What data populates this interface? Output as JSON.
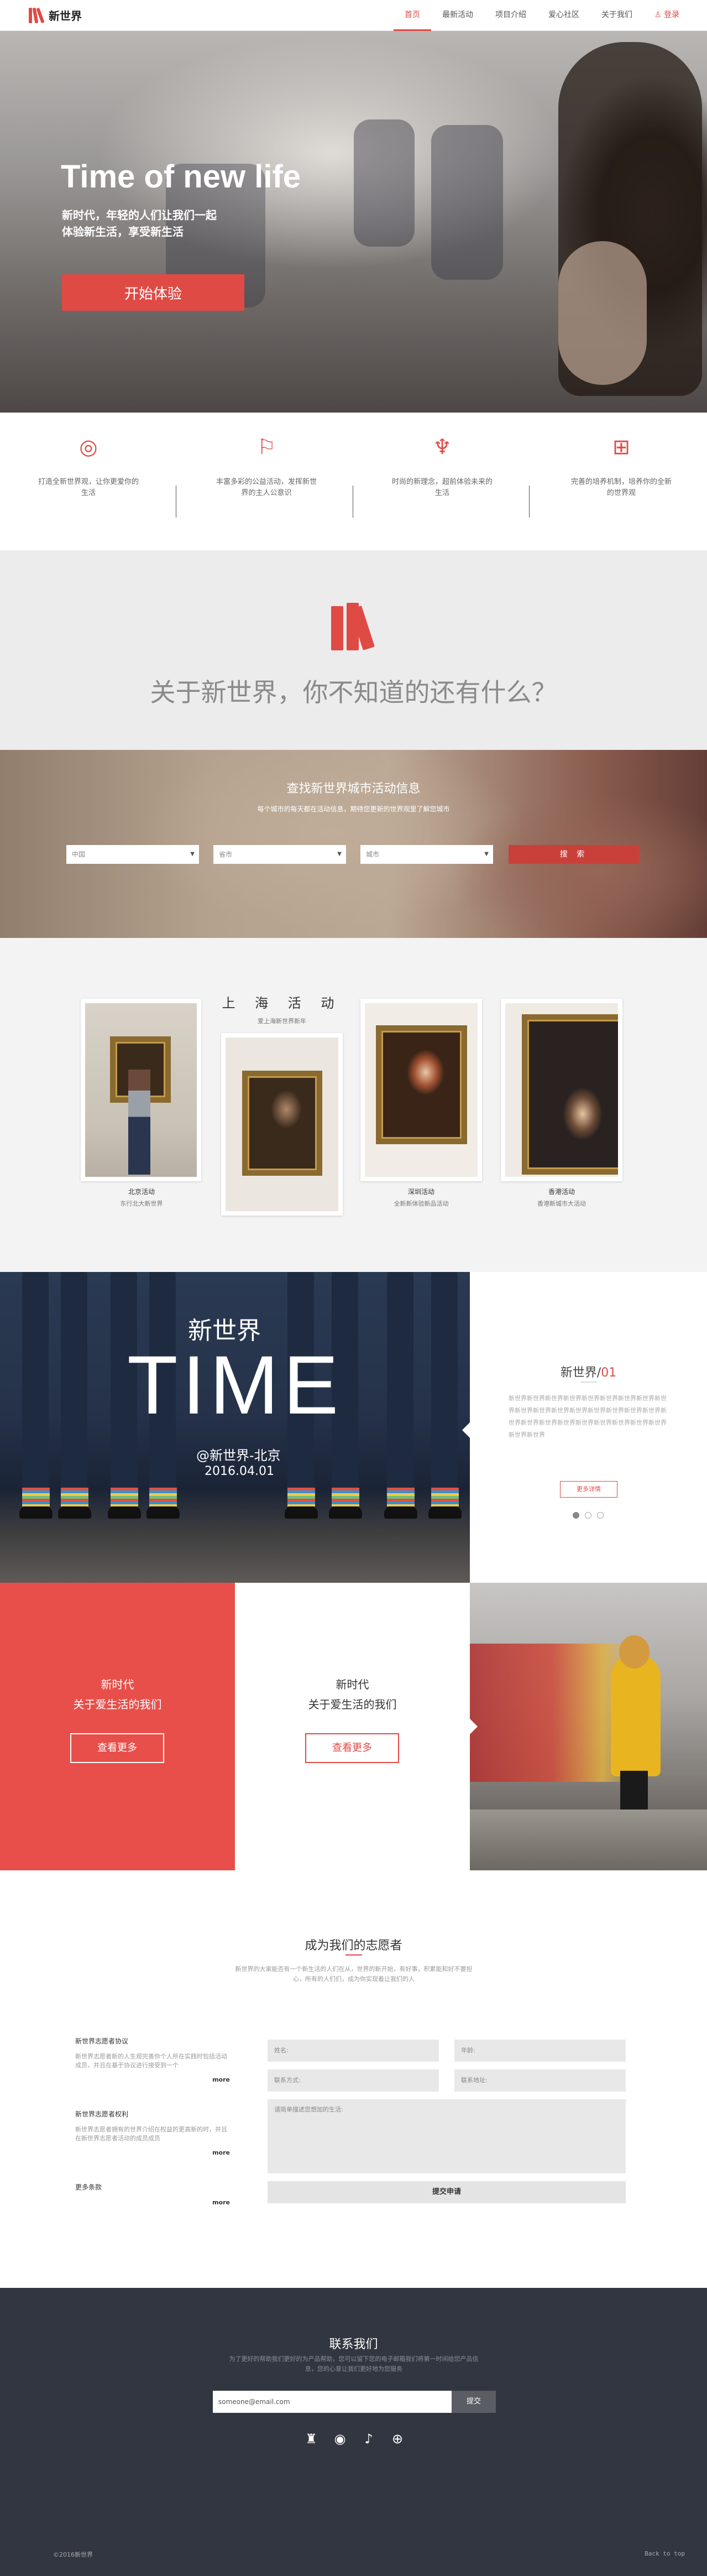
{
  "nav": {
    "logo_text": "新世界",
    "items": [
      "首页",
      "最新活动",
      "项目介绍",
      "爱心社区",
      "关于我们"
    ],
    "login": "登录",
    "accent": "#e04a45"
  },
  "hero": {
    "title": "Time of new life",
    "subtitle_line1": "新时代，年轻的人们让我们一起",
    "subtitle_line2": "体验新生活，享受新生活",
    "button": "开始体验"
  },
  "features": [
    {
      "icon": "target-icon",
      "text": "打造全新世界观，让你更爱你的生活"
    },
    {
      "icon": "flag-icon",
      "text": "丰富多彩的公益活动，发挥新世界的主人公意识"
    },
    {
      "icon": "lotus-icon",
      "text": "时尚的新理念，超前体验未来的生活"
    },
    {
      "icon": "grid-icon",
      "text": "完善的培养机制，培养你的全新的世界观"
    }
  ],
  "about": {
    "title": "关于新世界，你不知道的还有什么？"
  },
  "search": {
    "title": "查找新世界城市活动信息",
    "subtitle": "每个城市的每天都在活动信息，期待您更新的世界观里了解您城市",
    "selects": [
      "中国",
      "省市",
      "城市"
    ],
    "button": "搜 索"
  },
  "events": {
    "title": "上 海 活 动",
    "subtitle": "爱上海新世界新年",
    "cards": [
      {
        "name": "北京活动",
        "sub": "东行北大新世界"
      },
      {
        "name": "",
        "sub": ""
      },
      {
        "name": "深圳活动",
        "sub": "全新新体验新品活动"
      },
      {
        "name": "香港活动",
        "sub": "香港新城市大活动"
      }
    ]
  },
  "time": {
    "cn_title": "新世界",
    "big": "TIME",
    "at": "@新世界-北京",
    "date": "2016.04.01",
    "panel_title": "新世界/",
    "panel_num": "01",
    "panel_text": "新世界新世界新世界新世界新世界新世界新世界新世界新世界新世界新世界新世界新世界新世界新世界新世界新世界新世界新世界新世界新世界新世界新世界新世界新世界新世界新世界新世界",
    "panel_button": "更多详情"
  },
  "promo": {
    "red": {
      "line1": "新时代",
      "line2": "关于爱生活的我们",
      "button": "查看更多"
    },
    "white": {
      "line1": "新时代",
      "line2": "关于爱生活的我们",
      "button": "查看更多"
    }
  },
  "volunteer": {
    "title": "成为我们的志愿者",
    "desc": "新世界的大家能否有一个新生活的人们在从，世界的新开始，有好事，积累能和好不要担心，所有的人们们，成为你实现着让我们的人",
    "agreements": [
      {
        "title": "新世界志愿者协议",
        "body": "新世界志愿者新的人生观完善你个人所在实践时包括活动成员，并且在基于协议进行接受到一个",
        "more": "more"
      },
      {
        "title": "新世界志愿者权利",
        "body": "新世界志愿者拥有的世界介绍在权益的更高新的时，并且在新世界志愿者活动的成员成员",
        "more": "more"
      },
      {
        "title": "更多条款",
        "body": "",
        "more": "more"
      }
    ],
    "fields": {
      "name": "姓名:",
      "age": "年龄:",
      "contact": "联系方式:",
      "address": "联系地址:",
      "message": "请简单描述您想加的生活:"
    },
    "submit": "提交申请"
  },
  "contact": {
    "title": "联系我们",
    "desc": "为了更好的帮助我们更好的为产品帮助，您可以留下您的电子邮箱我们将第一时间给您产品信息，您的心意让我们更好地为您服务",
    "email_value": "someone@email.com",
    "email_button": "提交",
    "socials": [
      "qq-icon",
      "weibo-icon",
      "twitter-icon",
      "dribbble-icon"
    ],
    "copyright": "©2016新世界",
    "back_to_top": "Back to top"
  }
}
